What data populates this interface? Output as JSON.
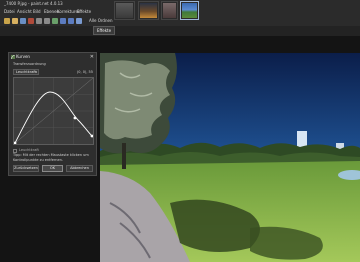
{
  "app": {
    "title": "_7400 P.jpg - paint.net 4.0.13"
  },
  "menu": {
    "items": [
      "Datei",
      "Ansicht",
      "Bild",
      "Ebenen",
      "Korrekturen",
      "Effekte"
    ]
  },
  "toolbar": {
    "zoom_label": "Alle Ordnen"
  },
  "tabs": {
    "active_label": "Effekte"
  },
  "curves_dialog": {
    "title": "Kurven",
    "section_label": "Transferzuordnung",
    "mode_value": "Leuchtkraft",
    "coords": "(0, 0), 55",
    "checkbox_label": "Leuchtkraft",
    "hint": "Tipp: Mit der rechten Maustaste klicken um Kontrollpunkte zu entfernen.",
    "reset_label": "Zurücksetzen",
    "ok_label": "OK",
    "cancel_label": "Abbrechen"
  },
  "colors": {
    "accent": "#9fb8d8",
    "dialog_bg": "#2e2e2e",
    "chrome": "#2b2b2b"
  }
}
